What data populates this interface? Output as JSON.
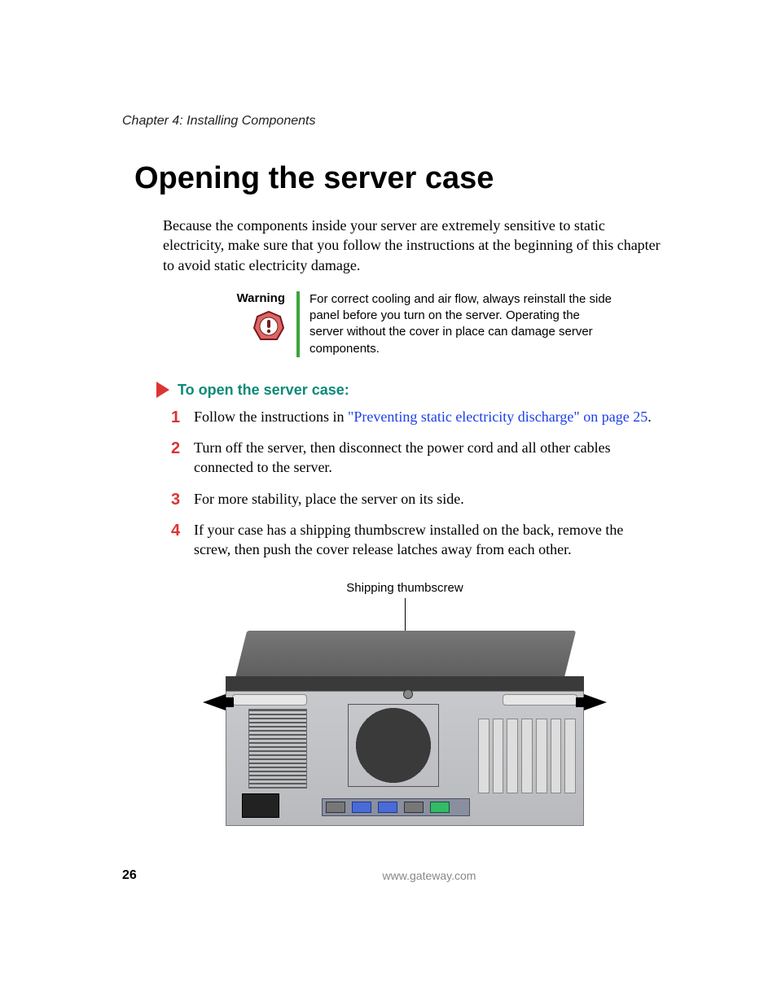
{
  "chapter_line": "Chapter 4: Installing Components",
  "title": "Opening the server case",
  "intro": "Because the components inside your server are extremely sensitive to static electricity, make sure that you follow the instructions at the beginning of this chapter to avoid static electricity damage.",
  "warning": {
    "label": "Warning",
    "text": "For correct cooling and air flow, always reinstall the side panel before you turn on the server. Operating the server without the cover in place can damage server components."
  },
  "procedure": {
    "title": "To open the server case:",
    "steps": [
      {
        "pre": "Follow the instructions in ",
        "link": "\"Preventing static electricity discharge\" on page 25",
        "post": "."
      },
      {
        "pre": "Turn off the server, then disconnect the power cord and all other cables connected to the server.",
        "link": "",
        "post": ""
      },
      {
        "pre": "For more stability, place the server on its side.",
        "link": "",
        "post": ""
      },
      {
        "pre": "If your case has a shipping thumbscrew installed on the back, remove the screw, then push the cover release latches away from each other.",
        "link": "",
        "post": ""
      }
    ]
  },
  "figure": {
    "caption": "Shipping thumbscrew"
  },
  "footer": {
    "page": "26",
    "site": "www.gateway.com"
  }
}
